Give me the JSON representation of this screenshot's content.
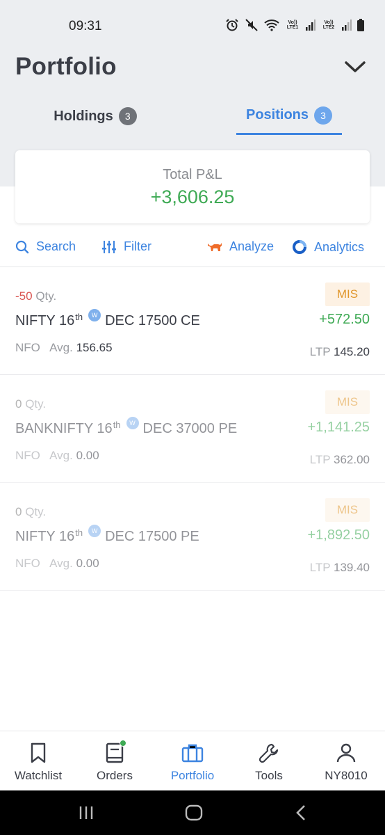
{
  "status_bar": {
    "time": "09:31",
    "sim1": "Vo)) LTE1",
    "sim2": "Vo)) LTE2"
  },
  "header": {
    "title": "Portfolio"
  },
  "tabs": [
    {
      "label": "Holdings",
      "count": "3",
      "active": false
    },
    {
      "label": "Positions",
      "count": "3",
      "active": true
    }
  ],
  "summary": {
    "label": "Total P&L",
    "value": "+3,606.25"
  },
  "toolbar": {
    "search": "Search",
    "filter": "Filter",
    "analyze": "Analyze",
    "analytics": "Analytics"
  },
  "positions": [
    {
      "qty": "-50",
      "qty_label": "Qty.",
      "name": "NIFTY 16",
      "suffix": "th",
      "expiry_badge": "W",
      "contract": "DEC 17500 CE",
      "exchange": "NFO",
      "avg_label": "Avg.",
      "avg": "156.65",
      "product": "MIS",
      "pnl": "+572.50",
      "ltp_label": "LTP",
      "ltp": "145.20"
    },
    {
      "qty": "0",
      "qty_label": "Qty.",
      "name": "BANKNIFTY 16",
      "suffix": "th",
      "expiry_badge": "W",
      "contract": "DEC 37000 PE",
      "exchange": "NFO",
      "avg_label": "Avg.",
      "avg": "0.00",
      "product": "MIS",
      "pnl": "+1,141.25",
      "ltp_label": "LTP",
      "ltp": "362.00"
    },
    {
      "qty": "0",
      "qty_label": "Qty.",
      "name": "NIFTY 16",
      "suffix": "th",
      "expiry_badge": "W",
      "contract": "DEC 17500 PE",
      "exchange": "NFO",
      "avg_label": "Avg.",
      "avg": "0.00",
      "product": "MIS",
      "pnl": "+1,892.50",
      "ltp_label": "LTP",
      "ltp": "139.40"
    }
  ],
  "bottom_nav": [
    {
      "label": "Watchlist",
      "icon": "bookmark-icon"
    },
    {
      "label": "Orders",
      "icon": "book-icon"
    },
    {
      "label": "Portfolio",
      "icon": "briefcase-icon",
      "active": true
    },
    {
      "label": "Tools",
      "icon": "wrench-icon"
    },
    {
      "label": "NY8010",
      "icon": "user-icon"
    }
  ],
  "colors": {
    "accent": "#3d84e0",
    "profit": "#3faa55",
    "loss": "#d9534f",
    "mis_bg": "#fdf1e3",
    "mis_text": "#e0962b"
  }
}
